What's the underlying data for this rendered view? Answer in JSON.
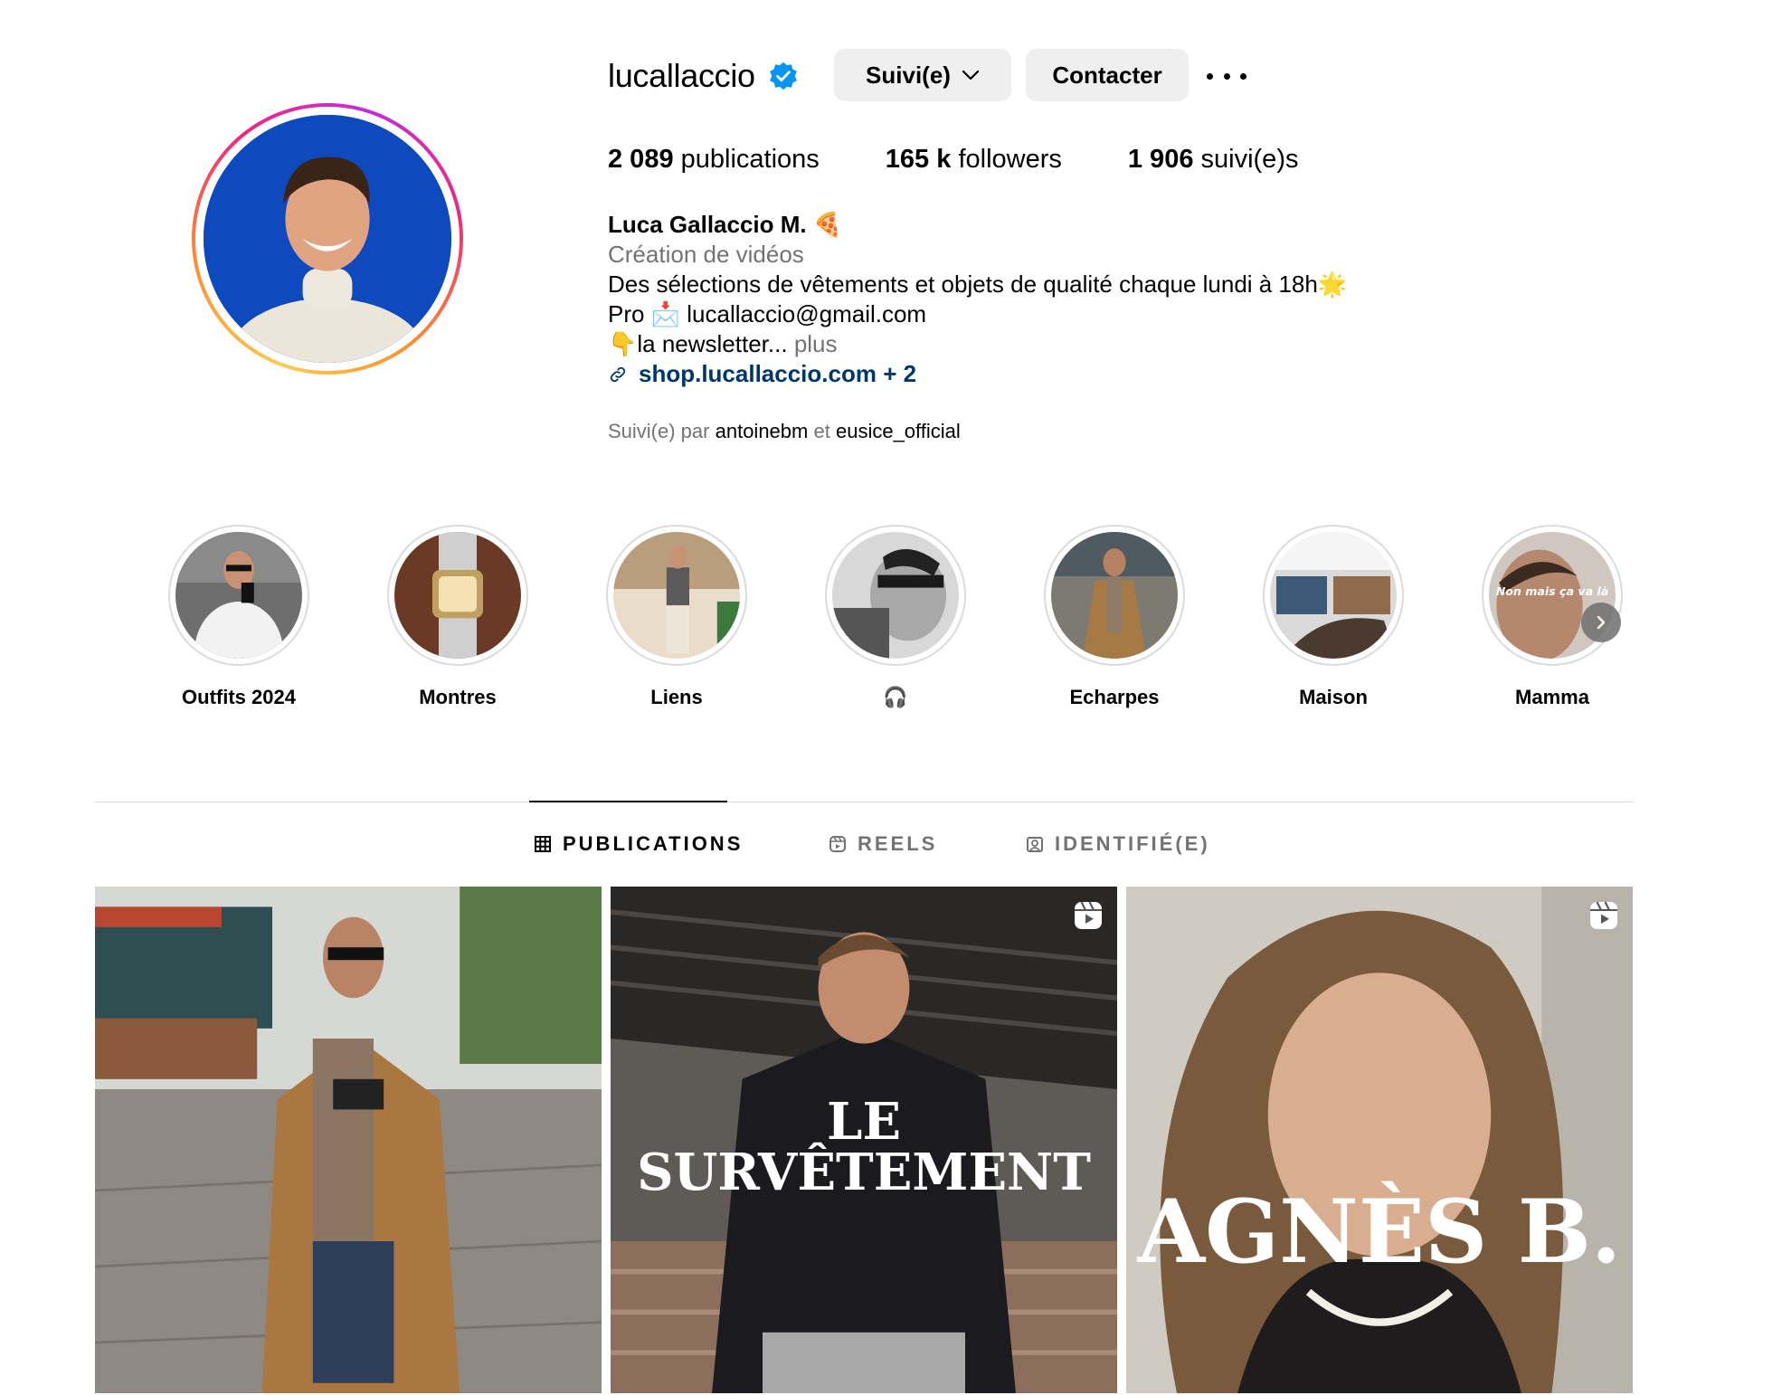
{
  "profile": {
    "username": "lucallaccio",
    "follow_button": "Suivi(e)",
    "contact_button": "Contacter",
    "stats": [
      {
        "value": "2 089",
        "label": "publications"
      },
      {
        "value": "165 k",
        "label": "followers"
      },
      {
        "value": "1 906",
        "label": "suivi(e)s"
      }
    ],
    "bio": {
      "name": "Luca Gallaccio M. 🍕",
      "category": "Création de vidéos",
      "line1": "Des sélections de vêtements et objets de qualité chaque lundi à 18h🌟",
      "line2": "Pro 📩 lucallaccio@gmail.com",
      "line3": "👇la newsletter...",
      "more": "plus",
      "link": "shop.lucallaccio.com + 2"
    },
    "followed_by": {
      "prefix": "Suivi(e) par",
      "user1": "antoinebm",
      "joiner": "et",
      "user2": "eusice_official"
    }
  },
  "highlights": [
    {
      "label": "Outfits 2024"
    },
    {
      "label": "Montres"
    },
    {
      "label": "Liens"
    },
    {
      "label": "🎧"
    },
    {
      "label": "Echarpes"
    },
    {
      "label": "Maison"
    },
    {
      "label": "Mamma"
    }
  ],
  "highlight_overlay_text": "Non mais ça va là",
  "tabs": [
    {
      "label": "PUBLICATIONS",
      "icon": "grid-icon",
      "active": true
    },
    {
      "label": "REELS",
      "icon": "reels-icon",
      "active": false
    },
    {
      "label": "IDENTIFIÉ(E)",
      "icon": "tagged-icon",
      "active": false
    }
  ],
  "posts": [
    {
      "type": "photo",
      "overlay": ""
    },
    {
      "type": "reel",
      "overlay_line1": "LE",
      "overlay_line2": "SURVÊTEMENT"
    },
    {
      "type": "reel",
      "overlay": "AGNÈS B."
    }
  ],
  "colors": {
    "link": "#00376b",
    "secondary_text": "#737373",
    "button_bg": "#efefef",
    "verified": "#0095f6",
    "avatar_bg": "#0f49be"
  }
}
